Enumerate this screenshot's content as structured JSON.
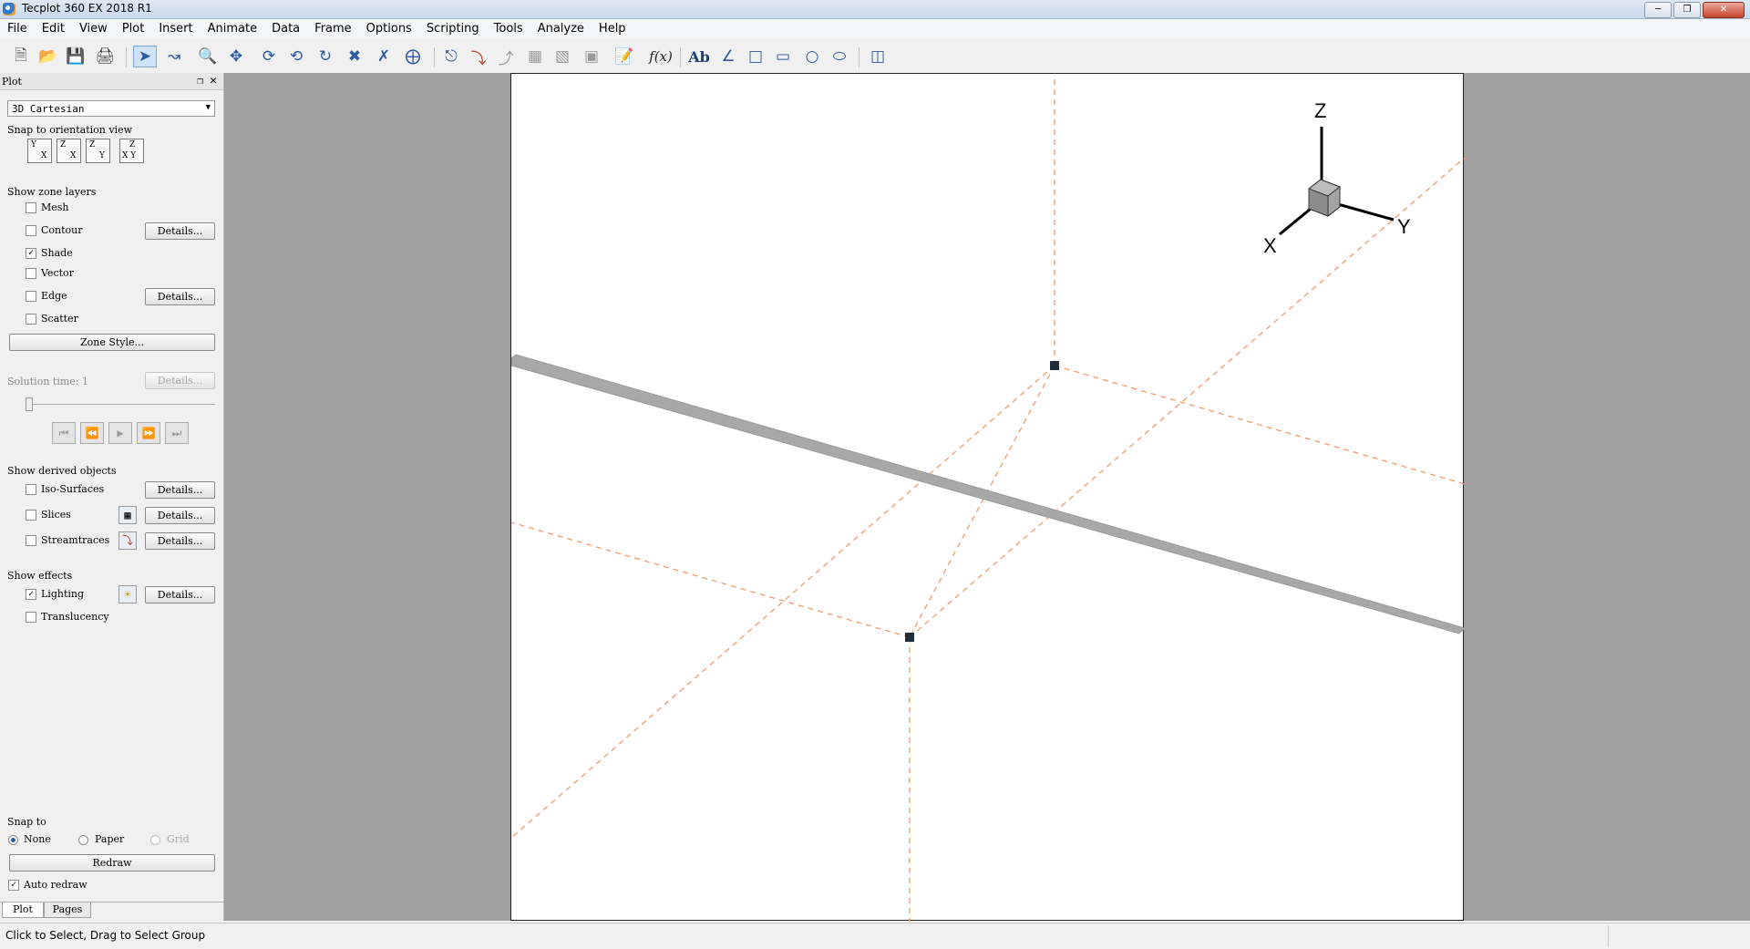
{
  "window": {
    "title": "Tecplot 360 EX 2018 R1"
  },
  "menu": [
    "File",
    "Edit",
    "View",
    "Plot",
    "Insert",
    "Animate",
    "Data",
    "Frame",
    "Options",
    "Scripting",
    "Tools",
    "Analyze",
    "Help"
  ],
  "toolbar_icons": [
    "new-file-icon",
    "open-file-icon",
    "save-icon",
    "print-icon",
    "select-arrow-icon",
    "adjustor-icon",
    "zoom-icon",
    "translate-icon",
    "rotate-x-icon",
    "rotate-y-icon",
    "rotate-roll-icon",
    "rotate-spherical-icon",
    "rotate-twist-icon",
    "rotate-center-icon",
    "probe-icon",
    "streamtrace-icon",
    "slice-icon",
    "contour-add-icon",
    "contour-remove-icon",
    "extract-icon",
    "data-workbench-icon",
    "equation-icon",
    "text-icon",
    "polyline-icon",
    "square-icon",
    "rectangle-icon",
    "circle-icon",
    "ellipse-icon",
    "frame-link-icon"
  ],
  "panel": {
    "header": "Plot",
    "plot_type": "3D Cartesian",
    "snap_orientation_label": "Snap to orientation view",
    "snap_buttons": [
      {
        "top": "Y",
        "bottom": "X"
      },
      {
        "top": "Z",
        "bottom": "X"
      },
      {
        "top": "Z",
        "bottom": "Y"
      },
      {
        "top": "Z",
        "bottom": "X Y"
      }
    ],
    "zone_layers_label": "Show zone layers",
    "layers": [
      {
        "label": "Mesh",
        "checked": false
      },
      {
        "label": "Contour",
        "checked": false
      },
      {
        "label": "Shade",
        "checked": true
      },
      {
        "label": "Vector",
        "checked": false
      },
      {
        "label": "Edge",
        "checked": false
      },
      {
        "label": "Scatter",
        "checked": false
      }
    ],
    "details_label": "Details...",
    "zone_style_label": "Zone Style...",
    "solution_time_label": "Solution time: 1",
    "derived_label": "Show derived objects",
    "derived": [
      {
        "label": "Iso-Surfaces",
        "checked": false
      },
      {
        "label": "Slices",
        "checked": false
      },
      {
        "label": "Streamtraces",
        "checked": false
      }
    ],
    "effects_label": "Show effects",
    "effects": [
      {
        "label": "Lighting",
        "checked": true
      },
      {
        "label": "Translucency",
        "checked": false
      }
    ],
    "snap_to_label": "Snap to",
    "snap_options": [
      {
        "label": "None",
        "selected": true
      },
      {
        "label": "Paper",
        "selected": false
      },
      {
        "label": "Grid",
        "selected": false
      }
    ],
    "redraw_label": "Redraw",
    "auto_redraw_label": "Auto redraw",
    "auto_redraw": true,
    "tabs": [
      "Plot",
      "Pages"
    ]
  },
  "axes_triad": {
    "x": "X",
    "y": "Y",
    "z": "Z"
  },
  "status": "Click to Select, Drag to Select Group",
  "colors": {
    "workspace": "#a0a0a0",
    "orange_dash": "#f29a6a",
    "bar": "#a8a8a8"
  }
}
